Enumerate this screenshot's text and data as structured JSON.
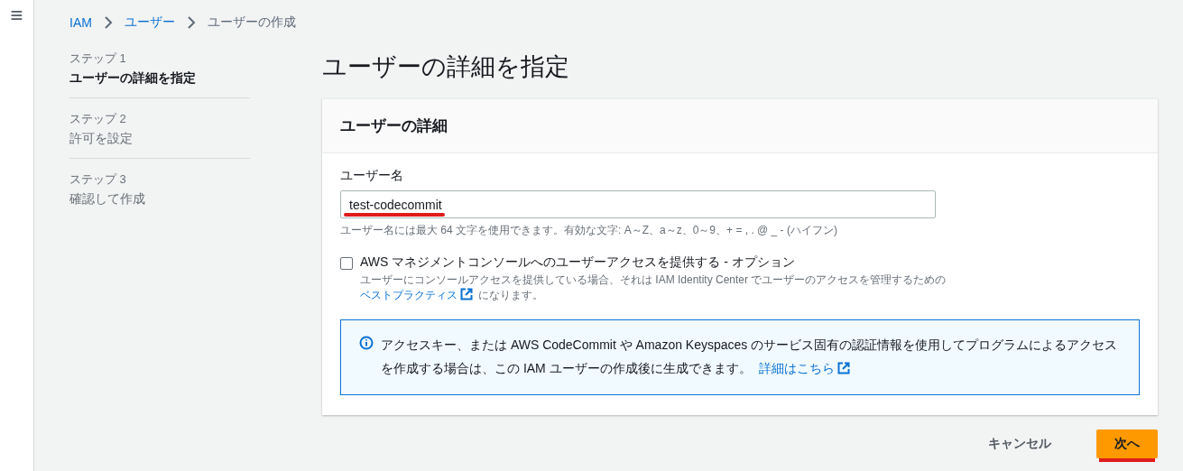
{
  "menu_button": {
    "label": "≡"
  },
  "breadcrumb": [
    {
      "label": "IAM",
      "kind": "link"
    },
    {
      "label": "ユーザー",
      "kind": "link"
    },
    {
      "label": "ユーザーの作成",
      "kind": "current"
    }
  ],
  "steps": [
    {
      "step": "ステップ 1",
      "title": "ユーザーの詳細を指定",
      "selected": true
    },
    {
      "step": "ステップ 2",
      "title": "許可を設定",
      "selected": false
    },
    {
      "step": "ステップ 3",
      "title": "確認して作成",
      "selected": false
    }
  ],
  "page_title": "ユーザーの詳細を指定",
  "card": {
    "title": "ユーザーの詳細",
    "user_name": {
      "label": "ユーザー名",
      "value": "test-codecommit",
      "underlined": true,
      "hint": "ユーザー名には最大 64 文字を使用できます。有効な文字: A～Z、a～z、0～9、+ = , . @ _ - (ハイフン)"
    },
    "console_access": {
      "label": "AWS マネジメントコンソールへのユーザーアクセスを提供する - オプション",
      "checked": false,
      "description": "ユーザーにコンソールアクセスを提供している場合、それは IAM Identity Center でユーザーのアクセスを管理するための",
      "link": "ベストプラクティス",
      "after_link": "になります。"
    },
    "info": {
      "text": "アクセスキー、または AWS CodeCommit や Amazon Keyspaces のサービス固有の認証情報を使用してプログラムによるアクセスを作成する場合は、この IAM ユーザーの作成後に生成できます。",
      "link": "詳細はこちら"
    }
  },
  "buttons": [
    {
      "label": "キャンセル",
      "kind": "link",
      "underlined": false
    },
    {
      "label": "次へ",
      "kind": "primary",
      "underlined": true
    }
  ]
}
